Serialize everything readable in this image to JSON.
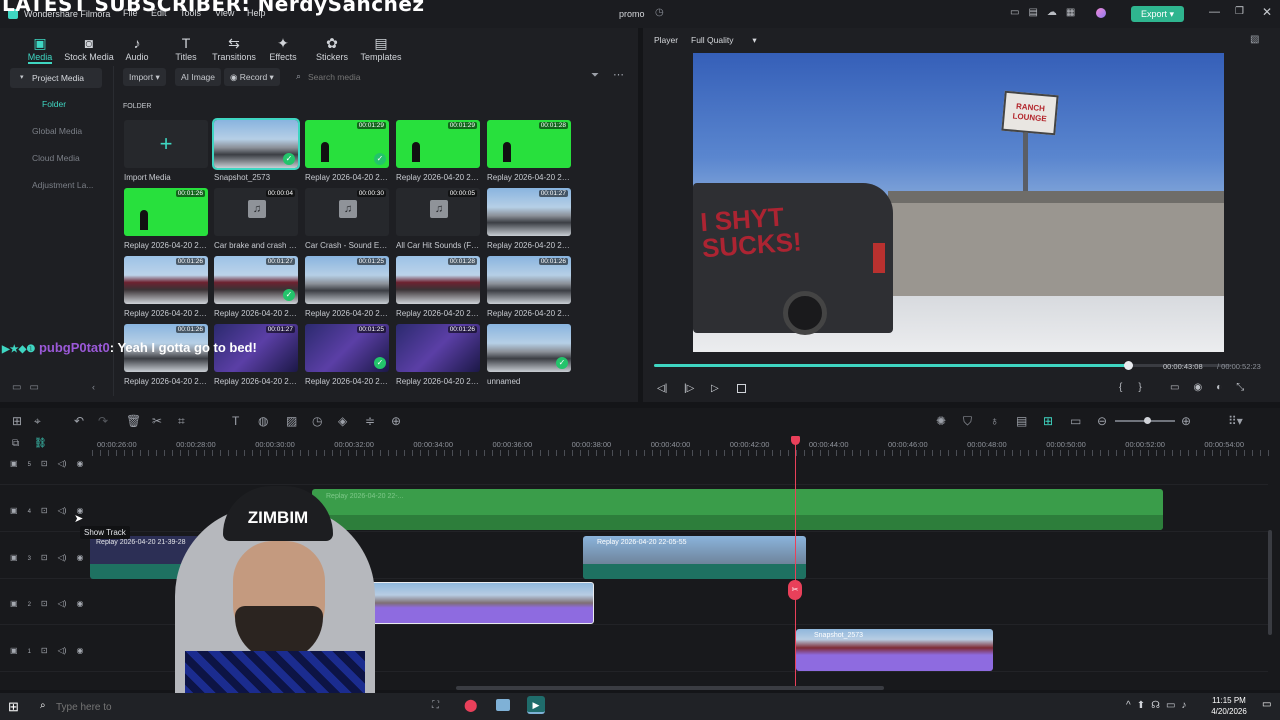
{
  "overlay": {
    "title": "LATEST SUBSCRIBER: NerdySanchez",
    "chat_user": "pubgP0tat0",
    "chat_message": ": Yeah I gotta go to bed!",
    "webcam_hat_text": "ZIMBIM"
  },
  "app": {
    "name": "Wondershare Filmora",
    "menu": [
      "File",
      "Edit",
      "Tools",
      "View",
      "Help"
    ],
    "project": "promo",
    "export_label": "Export"
  },
  "toolbar": {
    "tabs": [
      {
        "label": "Media",
        "icon": "media-icon",
        "glyph": "▣"
      },
      {
        "label": "Stock Media",
        "icon": "stock-media-icon",
        "glyph": "◙"
      },
      {
        "label": "Audio",
        "icon": "audio-icon",
        "glyph": "♪"
      },
      {
        "label": "Titles",
        "icon": "titles-icon",
        "glyph": "T"
      },
      {
        "label": "Transitions",
        "icon": "transitions-icon",
        "glyph": "⇆"
      },
      {
        "label": "Effects",
        "icon": "effects-icon",
        "glyph": "✦"
      },
      {
        "label": "Stickers",
        "icon": "stickers-icon",
        "glyph": "✿"
      },
      {
        "label": "Templates",
        "icon": "templates-icon",
        "glyph": "▤"
      }
    ]
  },
  "sidebar": {
    "items": [
      "Project Media",
      "Folder",
      "Global Media",
      "Cloud Media",
      "Adjustment La..."
    ]
  },
  "media_bar": {
    "import": "Import",
    "ai_image": "AI Image",
    "record": "Record",
    "search_placeholder": "Search media",
    "folder_label": "FOLDER"
  },
  "media": {
    "items": [
      {
        "label": "Import Media",
        "type": "import",
        "duration": ""
      },
      {
        "label": "Snapshot_2573",
        "type": "road",
        "duration": "",
        "selected": true,
        "check": true
      },
      {
        "label": "Replay 2026-04-20 22-...",
        "type": "green",
        "duration": "00:01:29",
        "check": true
      },
      {
        "label": "Replay 2026-04-20 22-...",
        "type": "green",
        "duration": "00:01:29"
      },
      {
        "label": "Replay 2026-04-20 22-...",
        "type": "green",
        "duration": "00:01:28"
      },
      {
        "label": "Replay 2026-04-20 22-...",
        "type": "green",
        "duration": "00:01:26"
      },
      {
        "label": "Car brake and crash S...",
        "type": "audio",
        "duration": "00:00:04"
      },
      {
        "label": "Car Crash - Sound Eff...",
        "type": "audio",
        "duration": "00:00:30"
      },
      {
        "label": "All Car Hit Sounds (Fo...",
        "type": "audio",
        "duration": "00:00:05"
      },
      {
        "label": "Replay 2026-04-20 22-...",
        "type": "road",
        "duration": "00:01:27"
      },
      {
        "label": "Replay 2026-04-20 22-...",
        "type": "van",
        "duration": "00:01:26"
      },
      {
        "label": "Replay 2026-04-20 22-...",
        "type": "van",
        "duration": "00:01:27",
        "check": true
      },
      {
        "label": "Replay 2026-04-20 22-...",
        "type": "road",
        "duration": "00:01:25"
      },
      {
        "label": "Replay 2026-04-20 22-...",
        "type": "van",
        "duration": "00:01:28"
      },
      {
        "label": "Replay 2026-04-20 22-...",
        "type": "road",
        "duration": "00:01:26"
      },
      {
        "label": "Replay 2026-04-20 22-...",
        "type": "road",
        "duration": "00:01:26"
      },
      {
        "label": "Replay 2026-04-20 21-...",
        "type": "stream",
        "duration": "00:01:27"
      },
      {
        "label": "Replay 2026-04-20 21-...",
        "type": "stream",
        "duration": "00:01:25",
        "check": true
      },
      {
        "label": "Replay 2026-04-20 21-...",
        "type": "stream",
        "duration": "00:01:26"
      },
      {
        "label": "unnamed",
        "type": "road",
        "duration": "",
        "check": true
      }
    ]
  },
  "player": {
    "tab": "Player",
    "quality": "Full Quality",
    "current_time": "00:00:43:08",
    "total_time": "/ 00:00:52:23",
    "progress": 0.82,
    "sign_text": "RANCH LOUNGE",
    "graffiti": "I SHYT SUCKS!"
  },
  "timeline": {
    "ruler": [
      "00:00:26:00",
      "00:00:28:00",
      "00:00:30:00",
      "00:00:32:00",
      "00:00:34:00",
      "00:00:36:00",
      "00:00:38:00",
      "00:00:40:00",
      "00:00:42:00",
      "00:00:44:00",
      "00:00:46:00",
      "00:00:48:00",
      "00:00:50:00",
      "00:00:52:00",
      "00:00:54:00"
    ],
    "tracks": [
      "5",
      "4",
      "3",
      "2",
      "1"
    ],
    "tooltip": "Show Track",
    "clips": {
      "track4": "Replay 2026-04-20 22-...",
      "track3a": "Replay 2026-04-20 21-39-28",
      "track3b": "Replay 2026-04-20 22-05-55",
      "track1": "Snapshot_2573"
    }
  },
  "taskbar": {
    "search_placeholder": "Type here to",
    "time": "11:15 PM",
    "date": "4/20/2026"
  },
  "colors": {
    "accent": "#3fd6c2",
    "export": "#2fb58f",
    "green_clip": "#3a9d4a",
    "purple_clip": "#8e6be0",
    "playhead": "#e9405a"
  }
}
